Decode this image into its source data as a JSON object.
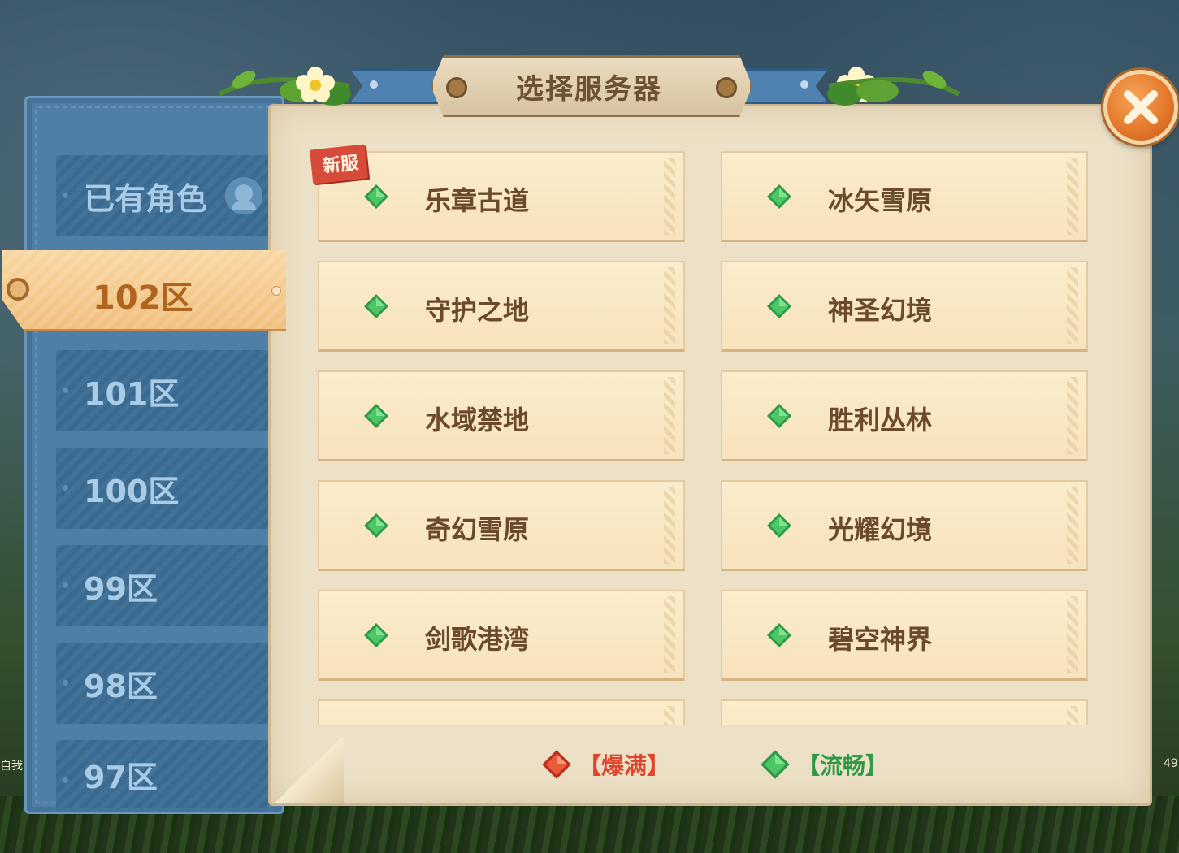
{
  "window": {
    "title": "选择服务器"
  },
  "background": {
    "left_edge_text": "自我",
    "right_edge_text": "49"
  },
  "sidebar": {
    "items": [
      {
        "label": "已有角色",
        "icon": "avatar-icon",
        "selected": false
      },
      {
        "label": "102区",
        "selected": true
      },
      {
        "label": "101区",
        "selected": false
      },
      {
        "label": "100区",
        "selected": false
      },
      {
        "label": "99区",
        "selected": false
      },
      {
        "label": "98区",
        "selected": false
      },
      {
        "label": "97区",
        "selected": false
      }
    ]
  },
  "servers": [
    {
      "name": "乐章古道",
      "status": "smooth",
      "badge": "新服"
    },
    {
      "name": "冰矢雪原",
      "status": "smooth"
    },
    {
      "name": "守护之地",
      "status": "smooth"
    },
    {
      "name": "神圣幻境",
      "status": "smooth"
    },
    {
      "name": "水域禁地",
      "status": "smooth"
    },
    {
      "name": "胜利丛林",
      "status": "smooth"
    },
    {
      "name": "奇幻雪原",
      "status": "smooth"
    },
    {
      "name": "光耀幻境",
      "status": "smooth"
    },
    {
      "name": "剑歌港湾",
      "status": "smooth"
    },
    {
      "name": "碧空神界",
      "status": "smooth"
    }
  ],
  "legend": {
    "full": {
      "label": "【爆满】",
      "color": "#e0442c",
      "icon": "red-gem-icon"
    },
    "smooth": {
      "label": "【流畅】",
      "color": "#2f9a45",
      "icon": "green-gem-icon"
    }
  },
  "colors": {
    "smooth_gem": "#3fb456",
    "full_gem": "#e0442c",
    "close_button": "#e57a2c",
    "selected_tab": "#f1bf7d"
  }
}
